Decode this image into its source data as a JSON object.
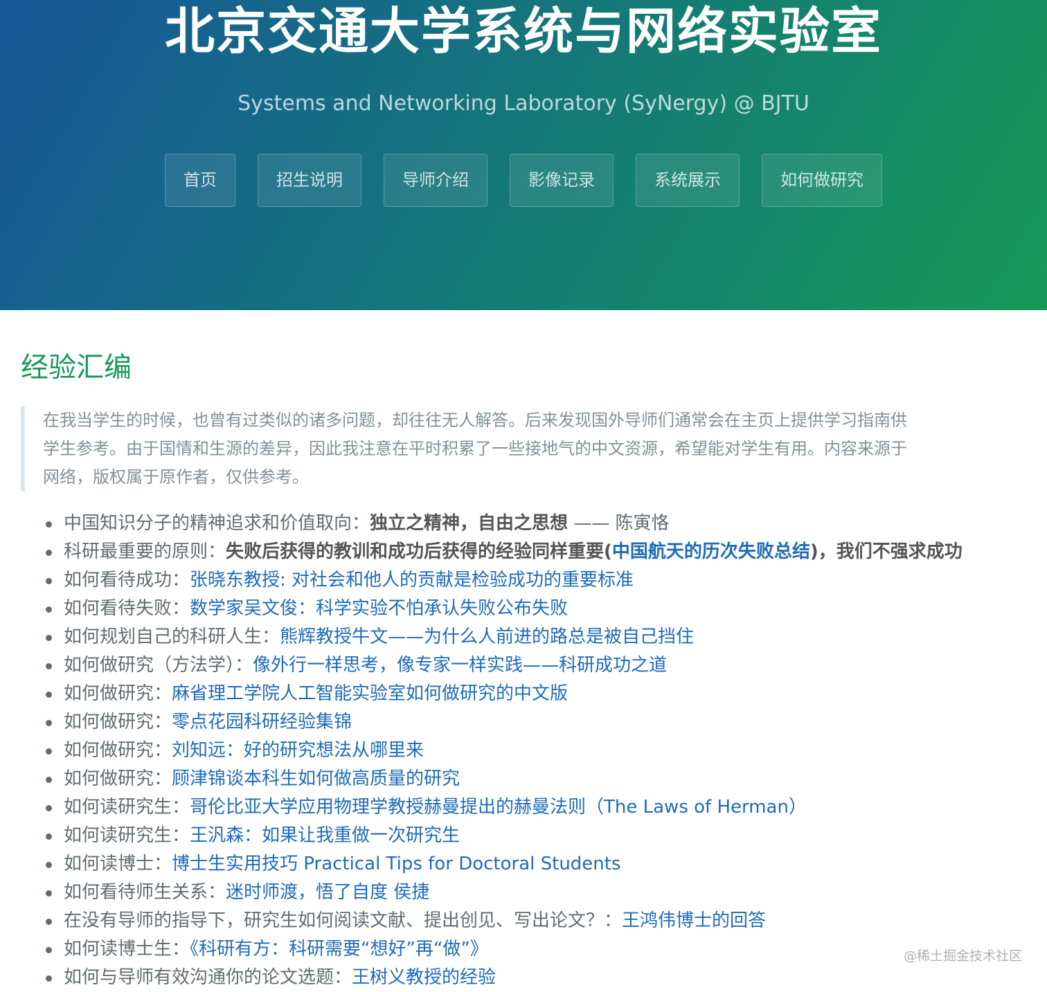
{
  "header": {
    "title": "北京交通大学系统与网络实验室",
    "subtitle": "Systems and Networking Laboratory (SyNergy) @ BJTU"
  },
  "nav": [
    "首页",
    "招生说明",
    "导师介绍",
    "影像记录",
    "系统展示",
    "如何做研究"
  ],
  "section": {
    "title": "经验汇编",
    "quote_lines": [
      "在我当学生的时候，也曾有过类似的诸多问题，却往往无人解答。后来发现国外导师们通常会在主页上提供学习指南供",
      "学生参考。由于国情和生源的差异，因此我注意在平时积累了一些接地气的中文资源，希望能对学生有用。内容来源于",
      "网络，版权属于原作者，仅供参考。"
    ]
  },
  "items": [
    {
      "label": "中国知识分子的精神追求和价值取向：",
      "bold": "独立之精神，自由之思想",
      "tail": " —— 陈寅恪"
    },
    {
      "label": "科研最重要的原则：",
      "bold_pre": "失败后获得的教训和成功后获得的经验同样重要(",
      "bold_link": "中国航天的历次失败总结",
      "bold_post": ")，我们不强求成功"
    },
    {
      "label": "如何看待成功：",
      "link": "张晓东教授: 对社会和他人的贡献是检验成功的重要标准"
    },
    {
      "label": "如何看待失败：",
      "link": "数学家吴文俊：科学实验不怕承认失败公布失败"
    },
    {
      "label": "如何规划自己的科研人生：",
      "link": "熊辉教授牛文——为什么人前进的路总是被自己挡住"
    },
    {
      "label": "如何做研究（方法学）：",
      "link": "像外行一样思考，像专家一样实践——科研成功之道"
    },
    {
      "label": "如何做研究：",
      "link": "麻省理工学院人工智能实验室如何做研究的中文版"
    },
    {
      "label": "如何做研究：",
      "link": "零点花园科研经验集锦"
    },
    {
      "label": "如何做研究：",
      "link": "刘知远：好的研究想法从哪里来"
    },
    {
      "label": "如何做研究：",
      "link": "顾津锦谈本科生如何做高质量的研究"
    },
    {
      "label": "如何读研究生：",
      "link": "哥伦比亚大学应用物理学教授赫曼提出的赫曼法则（The Laws of Herman）"
    },
    {
      "label": "如何读研究生：",
      "link": "王汎森：如果让我重做一次研究生"
    },
    {
      "label": "如何读博士：",
      "link": "博士生实用技巧 Practical Tips for Doctoral Students"
    },
    {
      "label": "如何看待师生关系：",
      "link": "迷时师渡，悟了自度 侯捷"
    },
    {
      "label": "在没有导师的指导下，研究生如何阅读文献、提出创见、写出论文？：",
      "link": "王鸿伟博士的回答"
    },
    {
      "label": "如何读博士生：",
      "link": "《科研有方：科研需要“想好”再“做”》"
    },
    {
      "label": "如何与导师有效沟通你的论文选题：",
      "link": "王树义教授的经验"
    }
  ],
  "watermark": "@稀土掘金技术社区"
}
